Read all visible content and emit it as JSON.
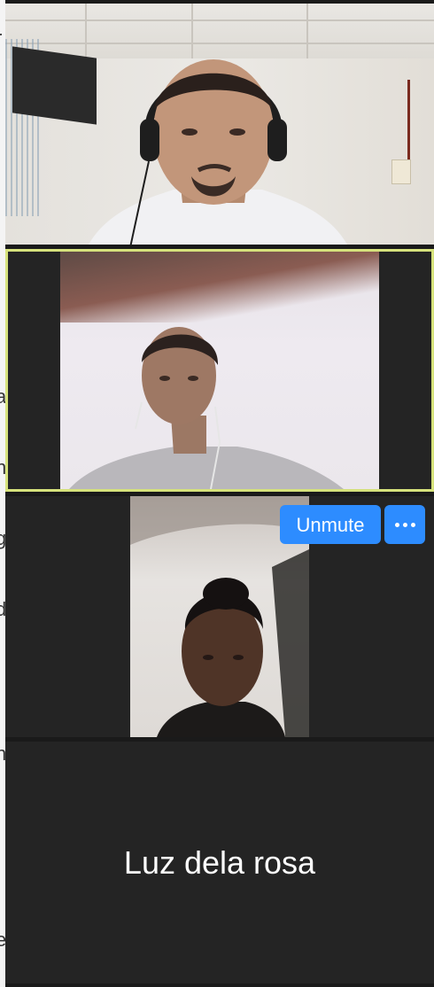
{
  "window": {
    "background_peek_glyphs": [
      "r",
      "a",
      "n",
      "g",
      "d",
      "n",
      "e"
    ]
  },
  "participants": [
    {
      "kind": "video",
      "active_speaker": false
    },
    {
      "kind": "video",
      "active_speaker": true,
      "highlight_color": "#d6e27c"
    },
    {
      "kind": "video",
      "active_speaker": false,
      "muted": true
    },
    {
      "kind": "name-only",
      "display_name": "Luz dela rosa"
    }
  ],
  "tile_controls": {
    "unmute_label": "Unmute",
    "more_icon": "more-horizontal-icon",
    "accent_color": "#2d8cff"
  }
}
